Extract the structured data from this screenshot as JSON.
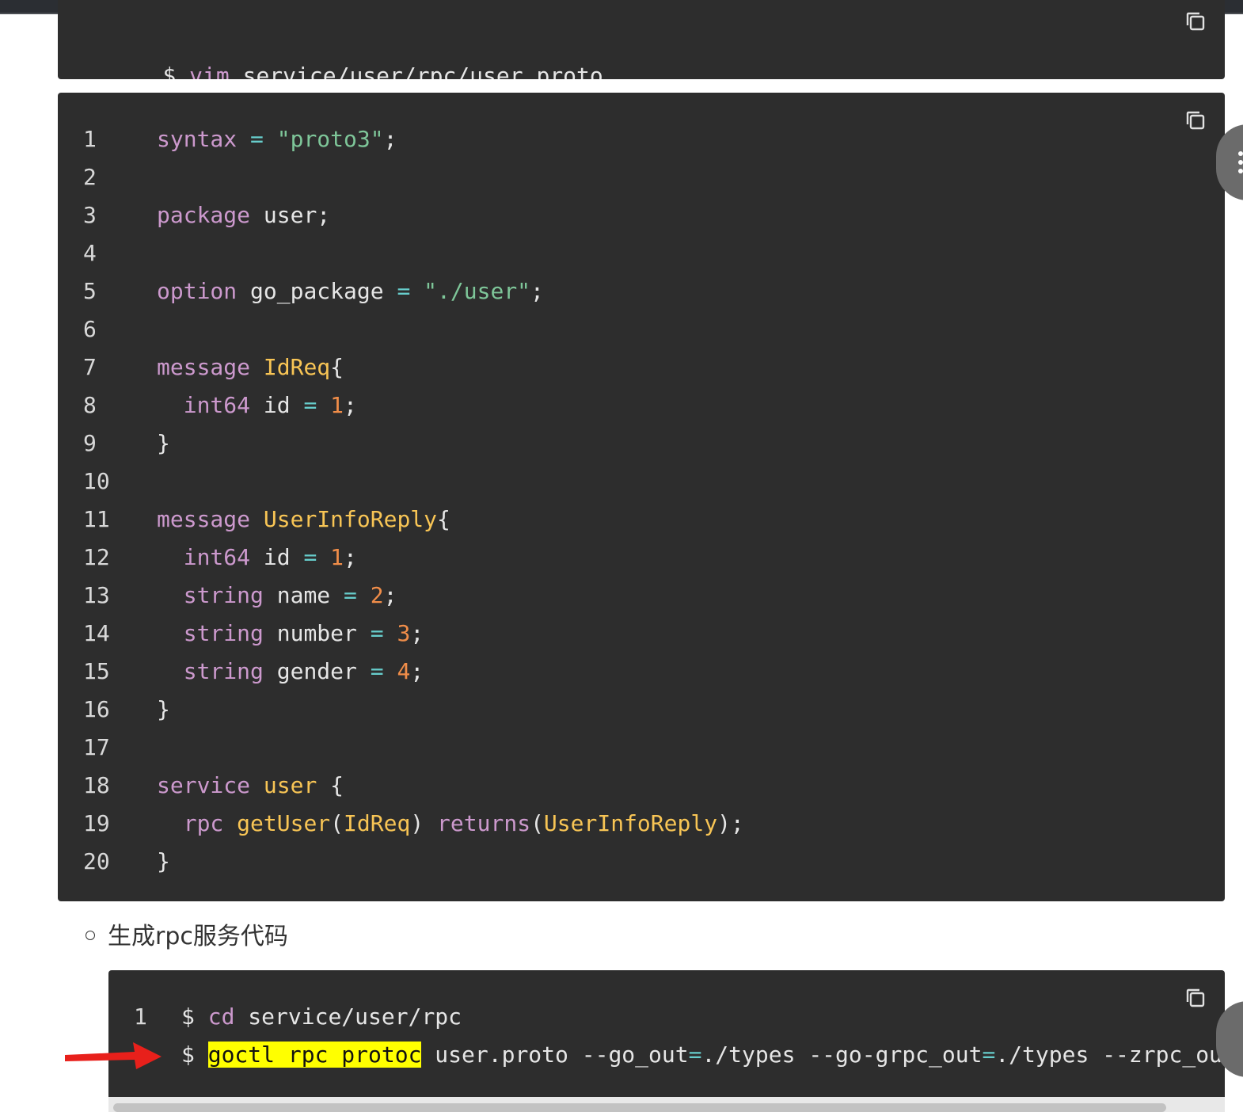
{
  "colors": {
    "code_bg": "#2d2d2d",
    "keyword": "#cc99cd",
    "string": "#7ec699",
    "operator": "#67cdcc",
    "number": "#f08d49",
    "function": "#f8c555",
    "highlight": "#ffff00",
    "arrow": "#e8201b"
  },
  "icons": {
    "copy": "copy-icon",
    "arrow": "red-arrow-annotation",
    "more": "more-icon"
  },
  "top_block": {
    "prompt": "$ ",
    "cmd": "vim",
    "args": " service/user/rpc/user.proto"
  },
  "proto_block": {
    "line_numbers": [
      "1",
      "2",
      "3",
      "4",
      "5",
      "6",
      "7",
      "8",
      "9",
      "10",
      "11",
      "12",
      "13",
      "14",
      "15",
      "16",
      "17",
      "18",
      "19",
      "20"
    ],
    "lines": [
      [
        [
          "kw",
          "syntax"
        ],
        [
          "def",
          " "
        ],
        [
          "op",
          "="
        ],
        [
          "def",
          " "
        ],
        [
          "str",
          "\"proto3\""
        ],
        [
          "def",
          ";"
        ]
      ],
      [],
      [
        [
          "kw",
          "package"
        ],
        [
          "def",
          " user;"
        ]
      ],
      [],
      [
        [
          "kw",
          "option"
        ],
        [
          "def",
          " go_package "
        ],
        [
          "op",
          "="
        ],
        [
          "def",
          " "
        ],
        [
          "str",
          "\"./user\""
        ],
        [
          "def",
          ";"
        ]
      ],
      [],
      [
        [
          "kw",
          "message"
        ],
        [
          "def",
          " "
        ],
        [
          "fn",
          "IdReq"
        ],
        [
          "def",
          "{"
        ]
      ],
      [
        [
          "def",
          "  "
        ],
        [
          "kw",
          "int64"
        ],
        [
          "def",
          " id "
        ],
        [
          "op",
          "="
        ],
        [
          "def",
          " "
        ],
        [
          "num",
          "1"
        ],
        [
          "def",
          ";"
        ]
      ],
      [
        [
          "def",
          "}"
        ]
      ],
      [],
      [
        [
          "kw",
          "message"
        ],
        [
          "def",
          " "
        ],
        [
          "fn",
          "UserInfoReply"
        ],
        [
          "def",
          "{"
        ]
      ],
      [
        [
          "def",
          "  "
        ],
        [
          "kw",
          "int64"
        ],
        [
          "def",
          " id "
        ],
        [
          "op",
          "="
        ],
        [
          "def",
          " "
        ],
        [
          "num",
          "1"
        ],
        [
          "def",
          ";"
        ]
      ],
      [
        [
          "def",
          "  "
        ],
        [
          "kw",
          "string"
        ],
        [
          "def",
          " name "
        ],
        [
          "op",
          "="
        ],
        [
          "def",
          " "
        ],
        [
          "num",
          "2"
        ],
        [
          "def",
          ";"
        ]
      ],
      [
        [
          "def",
          "  "
        ],
        [
          "kw",
          "string"
        ],
        [
          "def",
          " number "
        ],
        [
          "op",
          "="
        ],
        [
          "def",
          " "
        ],
        [
          "num",
          "3"
        ],
        [
          "def",
          ";"
        ]
      ],
      [
        [
          "def",
          "  "
        ],
        [
          "kw",
          "string"
        ],
        [
          "def",
          " gender "
        ],
        [
          "op",
          "="
        ],
        [
          "def",
          " "
        ],
        [
          "num",
          "4"
        ],
        [
          "def",
          ";"
        ]
      ],
      [
        [
          "def",
          "}"
        ]
      ],
      [],
      [
        [
          "kw",
          "service"
        ],
        [
          "def",
          " "
        ],
        [
          "fn",
          "user"
        ],
        [
          "def",
          " {"
        ]
      ],
      [
        [
          "def",
          "  "
        ],
        [
          "kw",
          "rpc"
        ],
        [
          "def",
          " "
        ],
        [
          "fn",
          "getUser"
        ],
        [
          "def",
          "("
        ],
        [
          "fn",
          "IdReq"
        ],
        [
          "def",
          ") "
        ],
        [
          "kw",
          "returns"
        ],
        [
          "def",
          "("
        ],
        [
          "fn",
          "UserInfoReply"
        ],
        [
          "def",
          ");"
        ]
      ],
      [
        [
          "def",
          "}"
        ]
      ]
    ]
  },
  "bullet_text": "生成rpc服务代码",
  "gen_block": {
    "line_numbers": [
      "1"
    ],
    "lines": [
      [
        [
          "def",
          "$ "
        ],
        [
          "kw",
          "cd"
        ],
        [
          "def",
          " service/user/rpc"
        ]
      ],
      [
        [
          "def",
          "$ "
        ],
        [
          "hl",
          "goctl rpc protoc"
        ],
        [
          "def",
          " user.proto --go_out"
        ],
        [
          "op",
          "="
        ],
        [
          "def",
          "./types --go-grpc_out"
        ],
        [
          "op",
          "="
        ],
        [
          "def",
          "./types --zrpc_out"
        ]
      ]
    ]
  }
}
